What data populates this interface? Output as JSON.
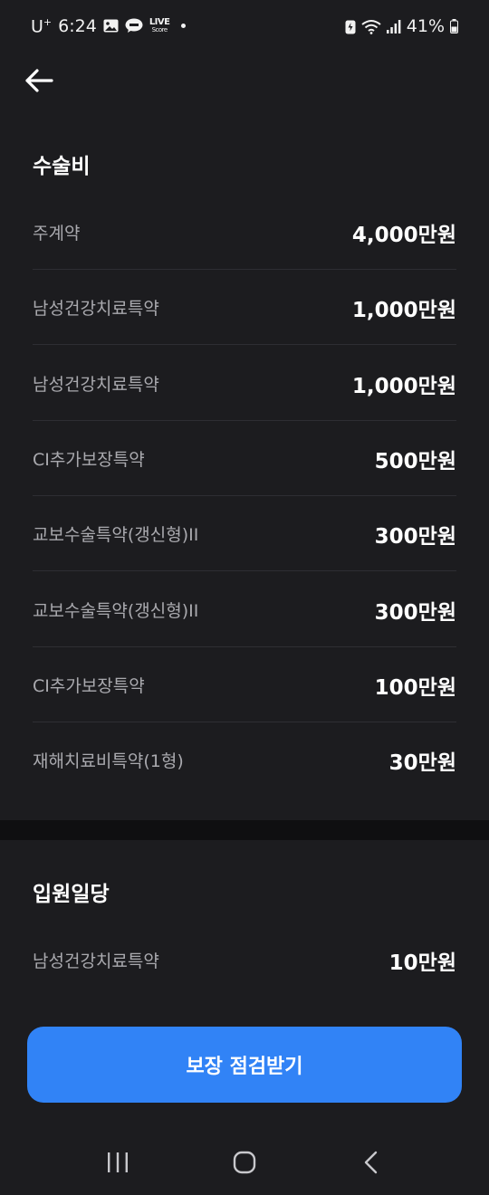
{
  "status_bar": {
    "carrier": "U",
    "carrier_sup": "+",
    "time": "6:24",
    "live_score_top": "LIVE",
    "live_score_bottom": "Score",
    "battery": "41%",
    "icons": [
      "image-icon",
      "talk-icon",
      "live-score-icon",
      "notification-dot",
      "battery-saver-icon",
      "wifi-icon",
      "signal-icon",
      "battery-icon"
    ]
  },
  "app_bar": {
    "back_icon": "arrow-left-icon"
  },
  "sections": [
    {
      "title": "수술비",
      "rows": [
        {
          "label": "주계약",
          "value": "4,000만원"
        },
        {
          "label": "남성건강치료특약",
          "value": "1,000만원"
        },
        {
          "label": "남성건강치료특약",
          "value": "1,000만원"
        },
        {
          "label": "CI추가보장특약",
          "value": "500만원"
        },
        {
          "label": "교보수술특약(갱신형)II",
          "value": "300만원"
        },
        {
          "label": "교보수술특약(갱신형)II",
          "value": "300만원"
        },
        {
          "label": "CI추가보장특약",
          "value": "100만원"
        },
        {
          "label": "재해치료비특약(1형)",
          "value": "30만원"
        }
      ]
    },
    {
      "title": "입원일당",
      "rows": [
        {
          "label": "남성건강치료특약",
          "value": "10만원"
        }
      ]
    }
  ],
  "cta": {
    "label": "보장 점검받기",
    "color": "#3183f6"
  },
  "nav_bar": {
    "items": [
      "recent-apps-icon",
      "home-icon",
      "back-icon"
    ]
  }
}
